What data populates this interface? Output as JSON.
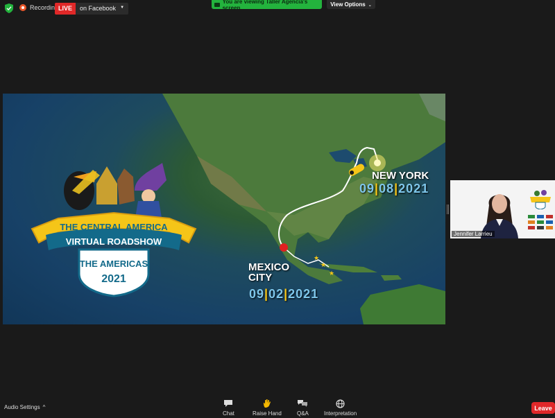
{
  "topbar": {
    "recording_label": "Recording",
    "live_badge": "LIVE",
    "live_destination": "on Facebook",
    "viewing_banner": "You are viewing Taller Agencia's screen",
    "view_options": "View Options"
  },
  "slide": {
    "logo_line1": "THE CENTRAL AMERICA",
    "logo_line2": "VIRTUAL ROADSHOW",
    "logo_sub": "THE AMERICAS",
    "logo_year": "2021",
    "dest_city": "NEW YORK",
    "dest_date": [
      "09",
      "08",
      "2021"
    ],
    "origin_city_line1": "MEXICO",
    "origin_city_line2": "CITY",
    "origin_date": [
      "09",
      "02",
      "2021"
    ]
  },
  "participant": {
    "name": "Jennifer Larrieu"
  },
  "toolbar": {
    "audio_settings": "Audio Settings",
    "chat": "Chat",
    "raise_hand": "Raise Hand",
    "qa": "Q&A",
    "interpretation": "Interpretation",
    "leave": "Leave"
  },
  "colors": {
    "live_red": "#e02828",
    "viewing_green": "#23b33d",
    "leave_red": "#e0282a",
    "date_blue": "#7ec6ea",
    "separator_yellow": "#f5c518"
  }
}
